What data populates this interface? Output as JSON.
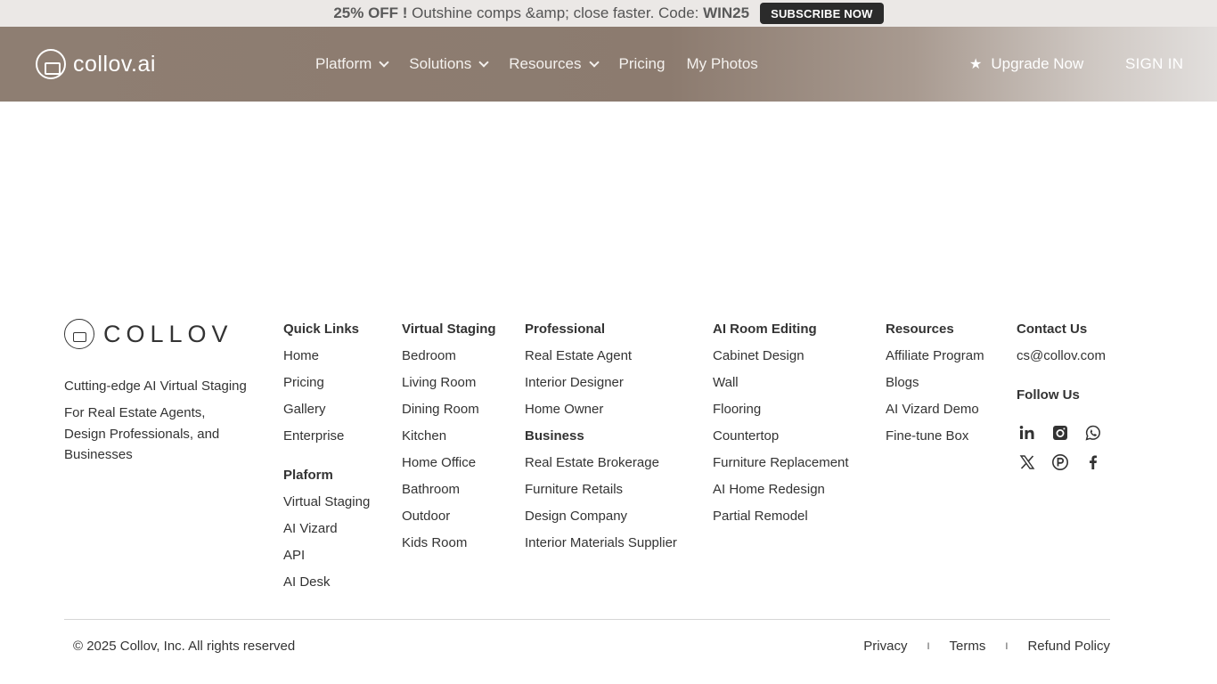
{
  "promo": {
    "highlight": "25% OFF !",
    "text": " Outshine comps &amp; close faster. Code: ",
    "code": "WIN25",
    "button": "SUBSCRIBE NOW"
  },
  "header": {
    "logo_text": "collov.ai",
    "nav": [
      {
        "label": "Platform",
        "dropdown": true
      },
      {
        "label": "Solutions",
        "dropdown": true
      },
      {
        "label": "Resources",
        "dropdown": true
      },
      {
        "label": "Pricing",
        "dropdown": false
      },
      {
        "label": "My Photos",
        "dropdown": false
      }
    ],
    "upgrade": "Upgrade Now",
    "signin": "SIGN IN"
  },
  "footer": {
    "logo_text": "COLLOV",
    "tagline": "Cutting-edge AI Virtual Staging",
    "audience": "For Real Estate Agents, Design Professionals, and Businesses",
    "quick_links": {
      "title": "Quick Links",
      "items": [
        "Home",
        "Pricing",
        "Gallery",
        "Enterprise"
      ],
      "platform_title": "Plaform",
      "platform_items": [
        "Virtual Staging",
        "AI Vizard",
        "API",
        "AI Desk"
      ]
    },
    "virtual_staging": {
      "title": "Virtual Staging",
      "items": [
        "Bedroom",
        "Living Room",
        "Dining Room",
        "Kitchen",
        "Home Office",
        "Bathroom",
        "Outdoor",
        "Kids Room"
      ]
    },
    "professional": {
      "title": "Professional",
      "items": [
        "Real Estate Agent",
        "Interior Designer",
        "Home Owner"
      ],
      "business_title": "Business",
      "business_items": [
        "Real Estate Brokerage",
        "Furniture Retails",
        "Design Company",
        "Interior Materials Supplier"
      ]
    },
    "ai_room_editing": {
      "title": "AI Room Editing",
      "items": [
        "Cabinet Design",
        "Wall",
        "Flooring",
        "Countertop",
        "Furniture Replacement",
        "AI Home Redesign",
        "Partial Remodel"
      ]
    },
    "resources": {
      "title": "Resources",
      "items": [
        "Affiliate Program",
        "Blogs",
        "AI Vizard Demo",
        "Fine-tune Box"
      ]
    },
    "contact": {
      "title": "Contact Us",
      "email": "cs@collov.com",
      "follow_title": "Follow Us",
      "socials": [
        "linkedin-icon",
        "instagram-icon",
        "whatsapp-icon",
        "x-icon",
        "producthunt-icon",
        "facebook-icon"
      ]
    },
    "copyright": "© 2025 Collov, Inc. All rights reserved",
    "legal": [
      "Privacy",
      "Terms",
      "Refund Policy"
    ],
    "legal_separator": "I"
  }
}
